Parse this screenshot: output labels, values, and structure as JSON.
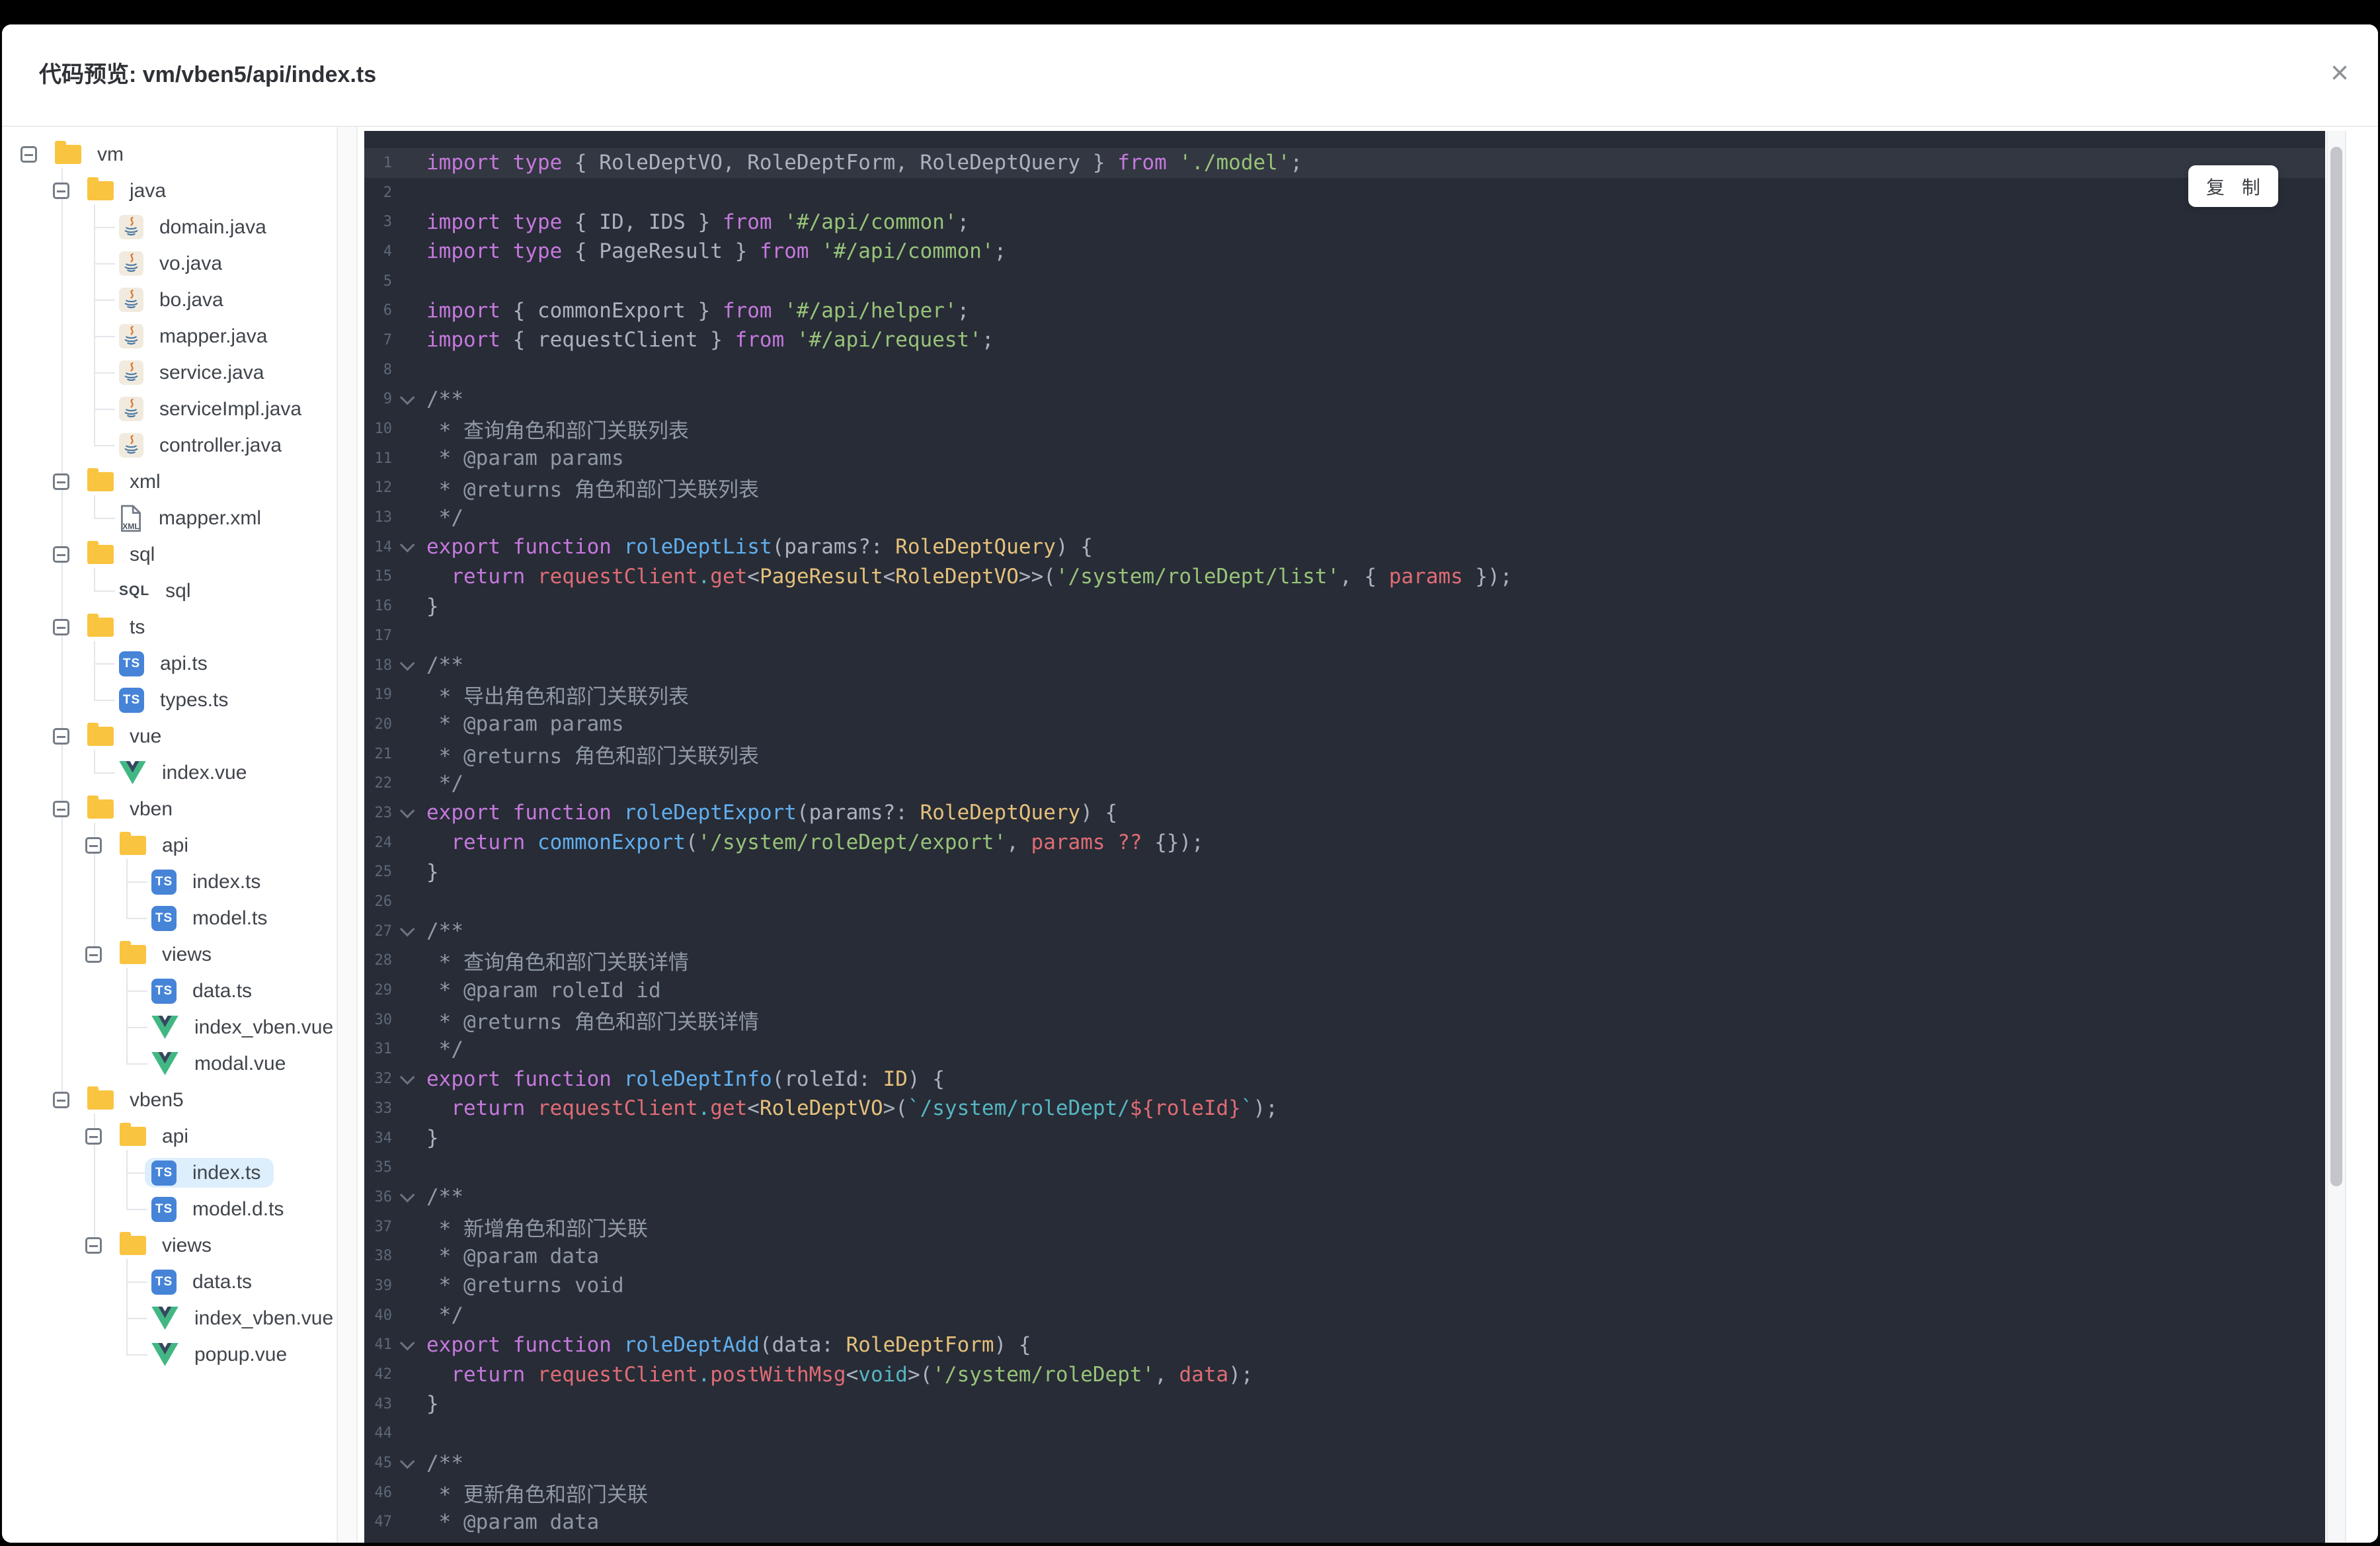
{
  "window": {
    "title": "代码预览: vm/vben5/api/index.ts",
    "close_icon": "×"
  },
  "code_panel": {
    "copy_label": "复 制"
  },
  "colors": {
    "code_background": "#272c36",
    "keyword": "#c678dd",
    "string": "#98c379",
    "template_string": "#56b6c2",
    "type": "#e5c07b",
    "function": "#61afef",
    "property": "#e06c75",
    "comment": "#9099a6",
    "default_text": "#abb2bf",
    "folder_icon": "#f9c440",
    "ts_icon": "#4684d8",
    "vue_icon_green": "#41b883",
    "vue_icon_dark": "#35495e",
    "selected_row": "#ddeefd"
  },
  "tree": {
    "items": [
      {
        "label": "vm",
        "kind": "folder",
        "depth": 0
      },
      {
        "label": "java",
        "kind": "folder",
        "depth": 1
      },
      {
        "label": "domain.java",
        "kind": "java",
        "depth": 2
      },
      {
        "label": "vo.java",
        "kind": "java",
        "depth": 2
      },
      {
        "label": "bo.java",
        "kind": "java",
        "depth": 2
      },
      {
        "label": "mapper.java",
        "kind": "java",
        "depth": 2
      },
      {
        "label": "service.java",
        "kind": "java",
        "depth": 2
      },
      {
        "label": "serviceImpl.java",
        "kind": "java",
        "depth": 2
      },
      {
        "label": "controller.java",
        "kind": "java",
        "depth": 2
      },
      {
        "label": "xml",
        "kind": "folder",
        "depth": 1
      },
      {
        "label": "mapper.xml",
        "kind": "xml",
        "depth": 2
      },
      {
        "label": "sql",
        "kind": "folder",
        "depth": 1
      },
      {
        "label": "sql",
        "kind": "sql",
        "depth": 2
      },
      {
        "label": "ts",
        "kind": "folder",
        "depth": 1
      },
      {
        "label": "api.ts",
        "kind": "ts",
        "depth": 2
      },
      {
        "label": "types.ts",
        "kind": "ts",
        "depth": 2
      },
      {
        "label": "vue",
        "kind": "folder",
        "depth": 1
      },
      {
        "label": "index.vue",
        "kind": "vue",
        "depth": 2
      },
      {
        "label": "vben",
        "kind": "folder",
        "depth": 1
      },
      {
        "label": "api",
        "kind": "folder",
        "depth": 2
      },
      {
        "label": "index.ts",
        "kind": "ts",
        "depth": 3
      },
      {
        "label": "model.ts",
        "kind": "ts",
        "depth": 3
      },
      {
        "label": "views",
        "kind": "folder",
        "depth": 2
      },
      {
        "label": "data.ts",
        "kind": "ts",
        "depth": 3
      },
      {
        "label": "index_vben.vue",
        "kind": "vue",
        "depth": 3
      },
      {
        "label": "modal.vue",
        "kind": "vue",
        "depth": 3
      },
      {
        "label": "vben5",
        "kind": "folder",
        "depth": 1
      },
      {
        "label": "api",
        "kind": "folder",
        "depth": 2
      },
      {
        "label": "index.ts",
        "kind": "ts",
        "depth": 3,
        "selected": true
      },
      {
        "label": "model.d.ts",
        "kind": "ts",
        "depth": 3
      },
      {
        "label": "views",
        "kind": "folder",
        "depth": 2
      },
      {
        "label": "data.ts",
        "kind": "ts",
        "depth": 3
      },
      {
        "label": "index_vben.vue",
        "kind": "vue",
        "depth": 3
      },
      {
        "label": "popup.vue",
        "kind": "vue",
        "depth": 3
      }
    ]
  },
  "code": {
    "lines": [
      {
        "n": 1,
        "hl": true,
        "tok": [
          [
            "k",
            "import type"
          ],
          [
            "d",
            " { RoleDeptVO, RoleDeptForm, RoleDeptQuery } "
          ],
          [
            "k",
            "from"
          ],
          [
            "d",
            " "
          ],
          [
            "s",
            "'./model'"
          ],
          [
            "d",
            ";"
          ]
        ]
      },
      {
        "n": 2,
        "tok": []
      },
      {
        "n": 3,
        "tok": [
          [
            "k",
            "import type"
          ],
          [
            "d",
            " { ID, IDS } "
          ],
          [
            "k",
            "from"
          ],
          [
            "d",
            " "
          ],
          [
            "s",
            "'#/api/common'"
          ],
          [
            "d",
            ";"
          ]
        ]
      },
      {
        "n": 4,
        "tok": [
          [
            "k",
            "import type"
          ],
          [
            "d",
            " { PageResult } "
          ],
          [
            "k",
            "from"
          ],
          [
            "d",
            " "
          ],
          [
            "s",
            "'#/api/common'"
          ],
          [
            "d",
            ";"
          ]
        ]
      },
      {
        "n": 5,
        "tok": []
      },
      {
        "n": 6,
        "tok": [
          [
            "k",
            "import"
          ],
          [
            "d",
            " { commonExport } "
          ],
          [
            "k",
            "from"
          ],
          [
            "d",
            " "
          ],
          [
            "s",
            "'#/api/helper'"
          ],
          [
            "d",
            ";"
          ]
        ]
      },
      {
        "n": 7,
        "tok": [
          [
            "k",
            "import"
          ],
          [
            "d",
            " { requestClient } "
          ],
          [
            "k",
            "from"
          ],
          [
            "d",
            " "
          ],
          [
            "s",
            "'#/api/request'"
          ],
          [
            "d",
            ";"
          ]
        ]
      },
      {
        "n": 8,
        "tok": []
      },
      {
        "n": 9,
        "fold": true,
        "tok": [
          [
            "c",
            "/**"
          ]
        ]
      },
      {
        "n": 10,
        "tok": [
          [
            "c",
            " * 查询角色和部门关联列表"
          ]
        ]
      },
      {
        "n": 11,
        "tok": [
          [
            "c",
            " * @param params"
          ]
        ]
      },
      {
        "n": 12,
        "tok": [
          [
            "c",
            " * @returns 角色和部门关联列表"
          ]
        ]
      },
      {
        "n": 13,
        "tok": [
          [
            "c",
            " */"
          ]
        ]
      },
      {
        "n": 14,
        "fold": true,
        "tok": [
          [
            "k",
            "export"
          ],
          [
            "d",
            " "
          ],
          [
            "k",
            "function"
          ],
          [
            "d",
            " "
          ],
          [
            "f",
            "roleDeptList"
          ],
          [
            "d",
            "(params?: "
          ],
          [
            "t",
            "RoleDeptQuery"
          ],
          [
            "d",
            ") {"
          ]
        ]
      },
      {
        "n": 15,
        "tok": [
          [
            "d",
            "  "
          ],
          [
            "k",
            "return"
          ],
          [
            "d",
            " "
          ],
          [
            "p",
            "requestClient"
          ],
          [
            "y",
            "."
          ],
          [
            "p",
            "get"
          ],
          [
            "d",
            "<"
          ],
          [
            "t",
            "PageResult"
          ],
          [
            "d",
            "<"
          ],
          [
            "t",
            "RoleDeptVO"
          ],
          [
            "d",
            ">>("
          ],
          [
            "s",
            "'/system/roleDept/list'"
          ],
          [
            "d",
            ", { "
          ],
          [
            "p",
            "params"
          ],
          [
            "d",
            " });"
          ]
        ]
      },
      {
        "n": 16,
        "tok": [
          [
            "d",
            "}"
          ]
        ]
      },
      {
        "n": 17,
        "tok": []
      },
      {
        "n": 18,
        "fold": true,
        "tok": [
          [
            "c",
            "/**"
          ]
        ]
      },
      {
        "n": 19,
        "tok": [
          [
            "c",
            " * 导出角色和部门关联列表"
          ]
        ]
      },
      {
        "n": 20,
        "tok": [
          [
            "c",
            " * @param params"
          ]
        ]
      },
      {
        "n": 21,
        "tok": [
          [
            "c",
            " * @returns 角色和部门关联列表"
          ]
        ]
      },
      {
        "n": 22,
        "tok": [
          [
            "c",
            " */"
          ]
        ]
      },
      {
        "n": 23,
        "fold": true,
        "tok": [
          [
            "k",
            "export"
          ],
          [
            "d",
            " "
          ],
          [
            "k",
            "function"
          ],
          [
            "d",
            " "
          ],
          [
            "f",
            "roleDeptExport"
          ],
          [
            "d",
            "(params?: "
          ],
          [
            "t",
            "RoleDeptQuery"
          ],
          [
            "d",
            ") {"
          ]
        ]
      },
      {
        "n": 24,
        "tok": [
          [
            "d",
            "  "
          ],
          [
            "k",
            "return"
          ],
          [
            "d",
            " "
          ],
          [
            "f",
            "commonExport"
          ],
          [
            "d",
            "("
          ],
          [
            "s",
            "'/system/roleDept/export'"
          ],
          [
            "d",
            ", "
          ],
          [
            "p",
            "params"
          ],
          [
            "d",
            " "
          ],
          [
            "p",
            "??"
          ],
          [
            "d",
            " {});"
          ]
        ]
      },
      {
        "n": 25,
        "tok": [
          [
            "d",
            "}"
          ]
        ]
      },
      {
        "n": 26,
        "tok": []
      },
      {
        "n": 27,
        "fold": true,
        "tok": [
          [
            "c",
            "/**"
          ]
        ]
      },
      {
        "n": 28,
        "tok": [
          [
            "c",
            " * 查询角色和部门关联详情"
          ]
        ]
      },
      {
        "n": 29,
        "tok": [
          [
            "c",
            " * @param roleId id"
          ]
        ]
      },
      {
        "n": 30,
        "tok": [
          [
            "c",
            " * @returns 角色和部门关联详情"
          ]
        ]
      },
      {
        "n": 31,
        "tok": [
          [
            "c",
            " */"
          ]
        ]
      },
      {
        "n": 32,
        "fold": true,
        "tok": [
          [
            "k",
            "export"
          ],
          [
            "d",
            " "
          ],
          [
            "k",
            "function"
          ],
          [
            "d",
            " "
          ],
          [
            "f",
            "roleDeptInfo"
          ],
          [
            "d",
            "(roleId: "
          ],
          [
            "t",
            "ID"
          ],
          [
            "d",
            ") {"
          ]
        ]
      },
      {
        "n": 33,
        "tok": [
          [
            "d",
            "  "
          ],
          [
            "k",
            "return"
          ],
          [
            "d",
            " "
          ],
          [
            "p",
            "requestClient"
          ],
          [
            "y",
            "."
          ],
          [
            "p",
            "get"
          ],
          [
            "d",
            "<"
          ],
          [
            "t",
            "RoleDeptVO"
          ],
          [
            "d",
            ">("
          ],
          [
            "y",
            "`/system/roleDept/"
          ],
          [
            "p",
            "${roleId}"
          ],
          [
            "y",
            "`"
          ],
          [
            "d",
            ");"
          ]
        ]
      },
      {
        "n": 34,
        "tok": [
          [
            "d",
            "}"
          ]
        ]
      },
      {
        "n": 35,
        "tok": []
      },
      {
        "n": 36,
        "fold": true,
        "tok": [
          [
            "c",
            "/**"
          ]
        ]
      },
      {
        "n": 37,
        "tok": [
          [
            "c",
            " * 新增角色和部门关联"
          ]
        ]
      },
      {
        "n": 38,
        "tok": [
          [
            "c",
            " * @param data"
          ]
        ]
      },
      {
        "n": 39,
        "tok": [
          [
            "c",
            " * @returns void"
          ]
        ]
      },
      {
        "n": 40,
        "tok": [
          [
            "c",
            " */"
          ]
        ]
      },
      {
        "n": 41,
        "fold": true,
        "tok": [
          [
            "k",
            "export"
          ],
          [
            "d",
            " "
          ],
          [
            "k",
            "function"
          ],
          [
            "d",
            " "
          ],
          [
            "f",
            "roleDeptAdd"
          ],
          [
            "d",
            "(data: "
          ],
          [
            "t",
            "RoleDeptForm"
          ],
          [
            "d",
            ") {"
          ]
        ]
      },
      {
        "n": 42,
        "tok": [
          [
            "d",
            "  "
          ],
          [
            "k",
            "return"
          ],
          [
            "d",
            " "
          ],
          [
            "p",
            "requestClient"
          ],
          [
            "y",
            "."
          ],
          [
            "p",
            "postWithMsg"
          ],
          [
            "d",
            "<"
          ],
          [
            "y",
            "void"
          ],
          [
            "d",
            ">("
          ],
          [
            "s",
            "'/system/roleDept'"
          ],
          [
            "d",
            ", "
          ],
          [
            "p",
            "data"
          ],
          [
            "d",
            ");"
          ]
        ]
      },
      {
        "n": 43,
        "tok": [
          [
            "d",
            "}"
          ]
        ]
      },
      {
        "n": 44,
        "tok": []
      },
      {
        "n": 45,
        "fold": true,
        "tok": [
          [
            "c",
            "/**"
          ]
        ]
      },
      {
        "n": 46,
        "tok": [
          [
            "c",
            " * 更新角色和部门关联"
          ]
        ]
      },
      {
        "n": 47,
        "tok": [
          [
            "c",
            " * @param data"
          ]
        ]
      }
    ]
  }
}
